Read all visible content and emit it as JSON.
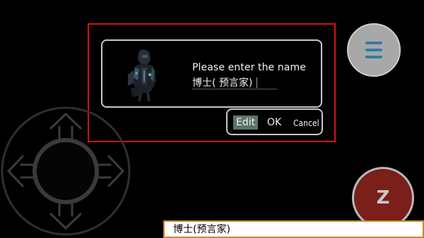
{
  "dialog": {
    "prompt": "Please enter the name",
    "name_value": "博士(  预言家)"
  },
  "actions": {
    "edit_label": "Edit",
    "ok_label": "OK",
    "cancel_label": "Cancel"
  },
  "controls": {
    "z_label": "Z",
    "menu_icon": "hamburger-menu-icon",
    "dpad_icon": "virtual-dpad"
  },
  "input_bar": {
    "text": "博士(预言家)"
  },
  "colors": {
    "highlight": "#d0121a",
    "edit_bg": "#5d7469",
    "menu_bars": "#2b7fa6",
    "z_button": "#7a1f1a",
    "input_border": "#c88a2b"
  }
}
